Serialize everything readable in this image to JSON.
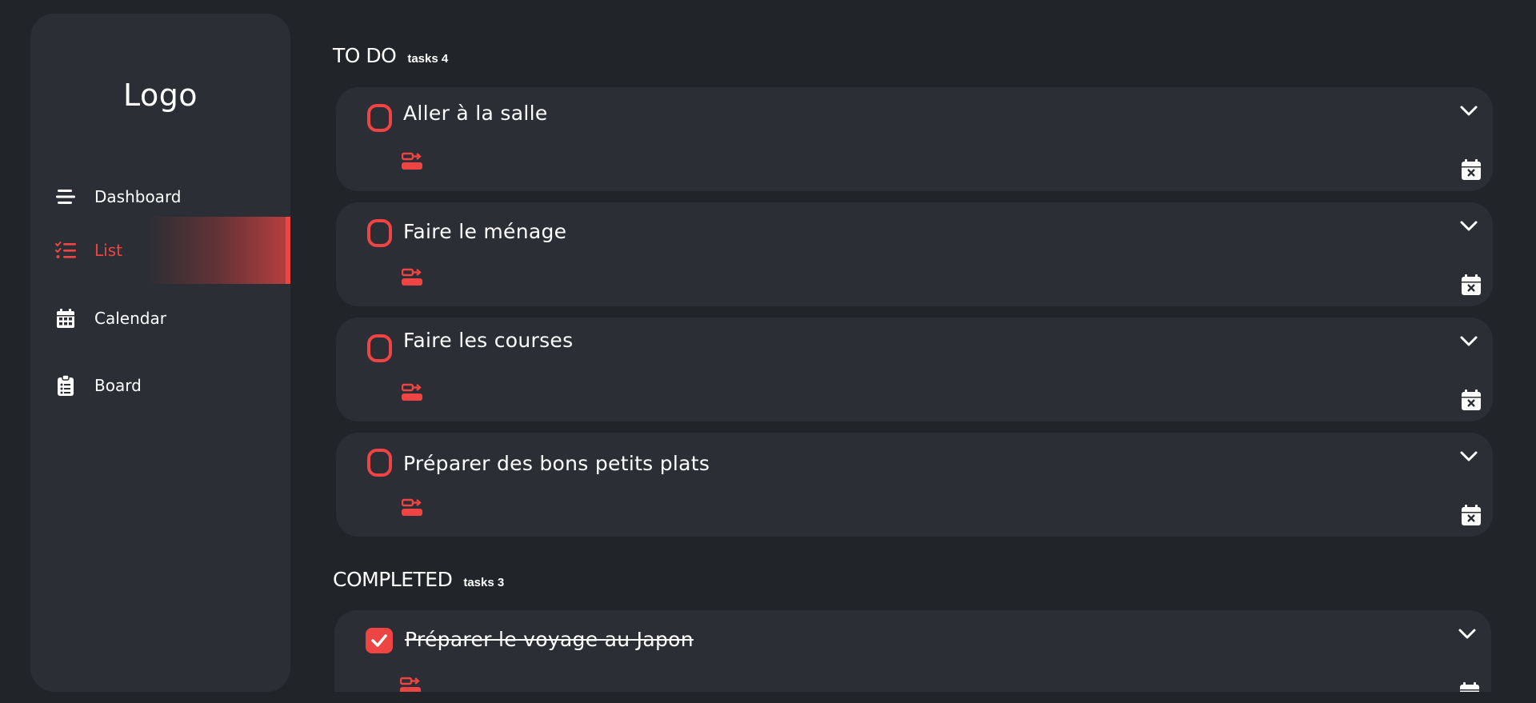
{
  "sidebar": {
    "logo": "Logo",
    "items": [
      {
        "label": "Dashboard",
        "icon": "bars-icon",
        "active": false
      },
      {
        "label": "List",
        "icon": "list-check-icon",
        "active": true
      },
      {
        "label": "Calendar",
        "icon": "calendar-icon",
        "active": false
      },
      {
        "label": "Board",
        "icon": "clipboard-list-icon",
        "active": false
      }
    ]
  },
  "todo": {
    "title": "TO DO",
    "count": "tasks 4",
    "tasks": [
      {
        "title": "Aller à la salle",
        "done": false
      },
      {
        "title": "Faire le ménage",
        "done": false
      },
      {
        "title": "Faire les courses",
        "done": false
      },
      {
        "title": "Préparer des bons petits plats",
        "done": false
      }
    ]
  },
  "completed": {
    "title": "COMPLETED",
    "count": "tasks 3",
    "tasks": [
      {
        "title": "Préparer le voyage au Japon",
        "done": true
      }
    ]
  },
  "colors": {
    "background": "#212428",
    "panel": "#2b2e34",
    "accent": "#ee4444",
    "text": "#ffffff"
  }
}
